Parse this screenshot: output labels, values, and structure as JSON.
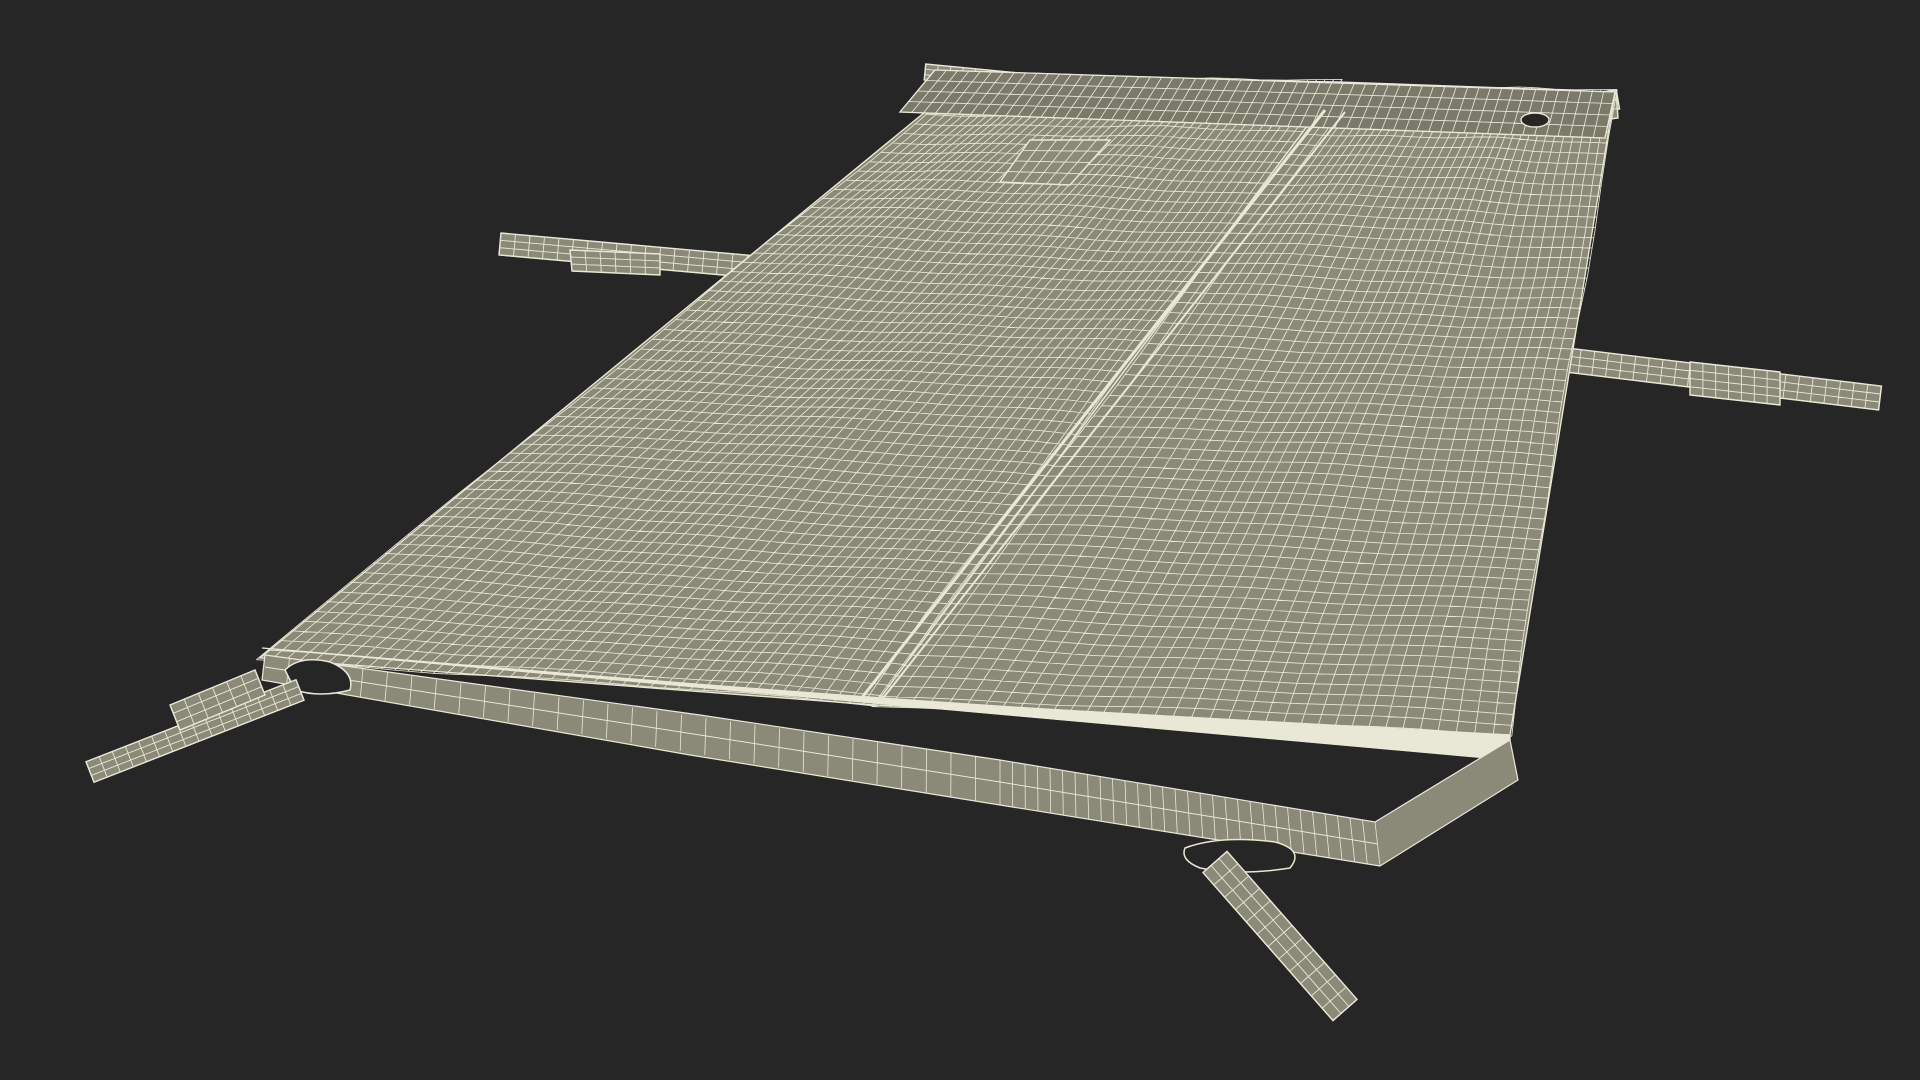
{
  "scene": {
    "background_color": "#262626",
    "fabric_color": "#8b8a78",
    "fabric_shadow_color": "#7a796a",
    "wire_color": "#e9e7d6",
    "subject": "stretcher-wireframe"
  }
}
